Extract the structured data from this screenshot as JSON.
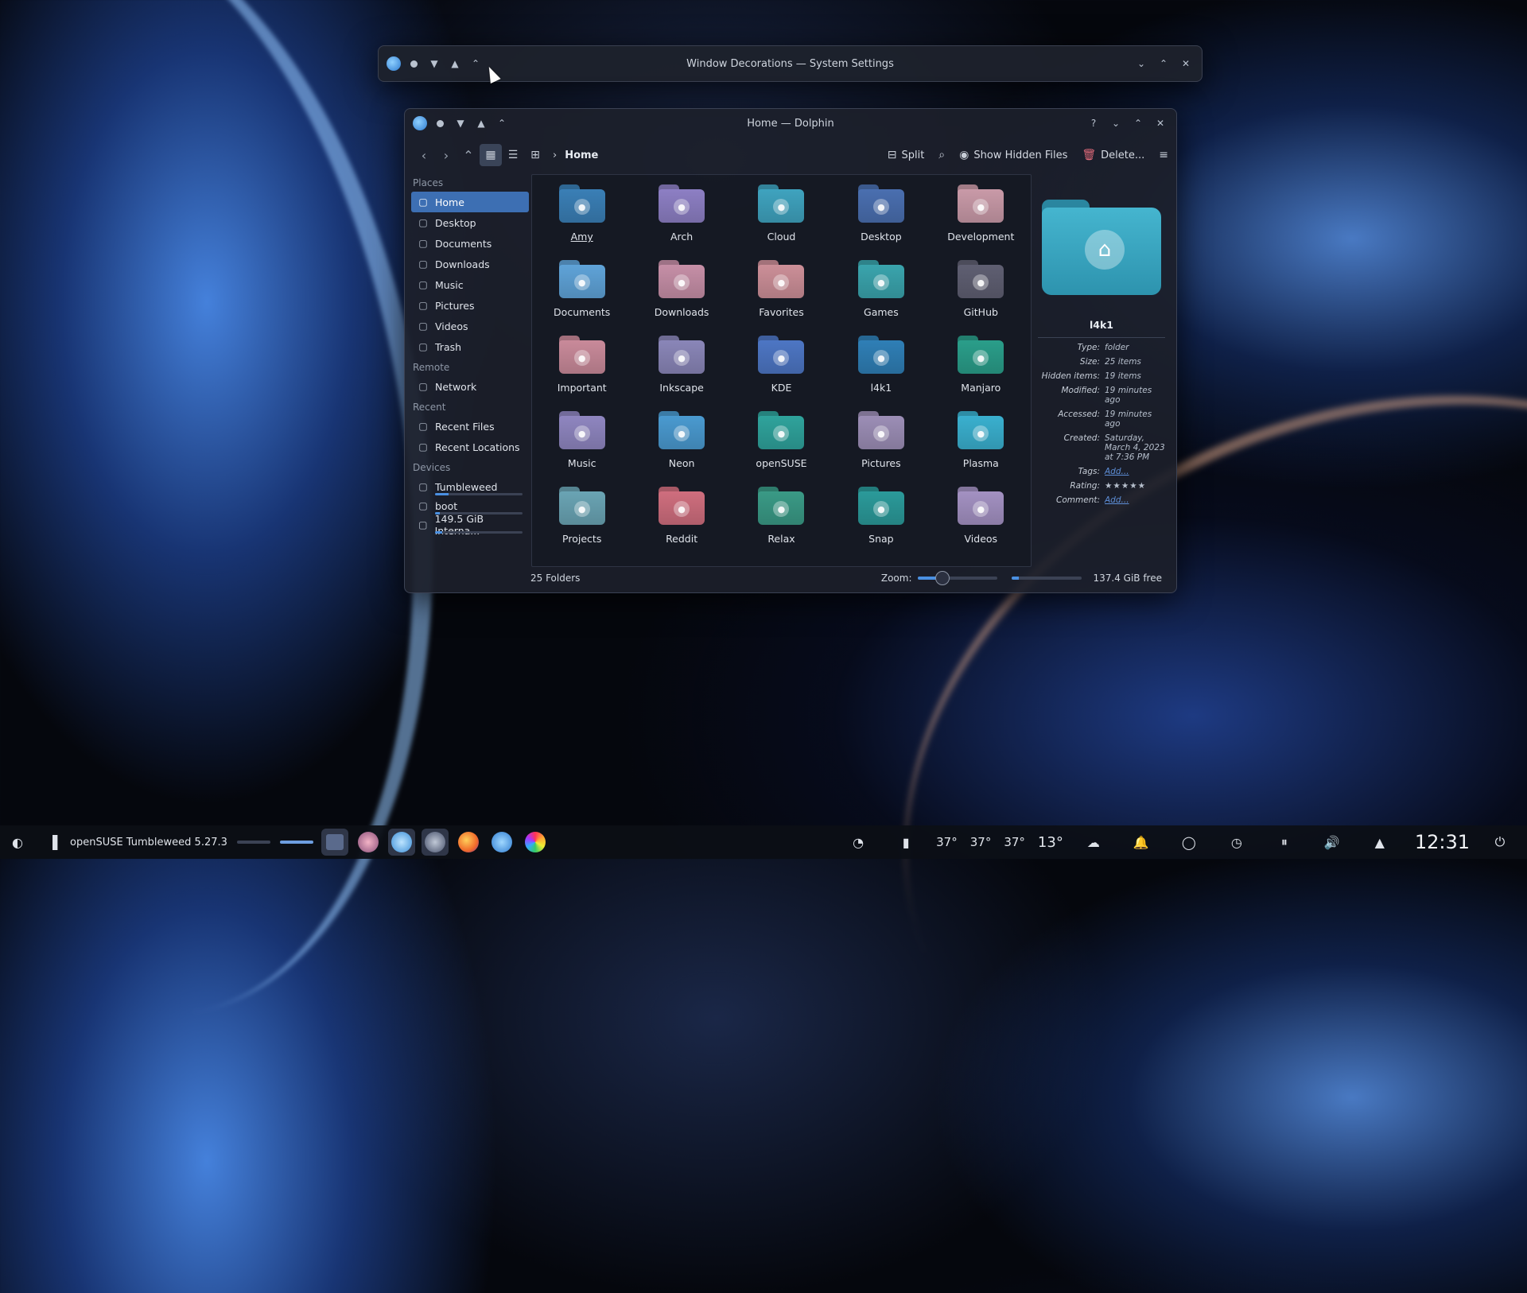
{
  "settings_window": {
    "title": "Window Decorations — System Settings"
  },
  "dolphin": {
    "title": "Home — Dolphin",
    "breadcrumb": "Home",
    "toolbar": {
      "split": "Split",
      "show_hidden": "Show Hidden Files",
      "delete": "Delete..."
    },
    "sidebar": {
      "places_label": "Places",
      "places": [
        {
          "label": "Home",
          "icon": "home-icon"
        },
        {
          "label": "Desktop",
          "icon": "desktop-icon"
        },
        {
          "label": "Documents",
          "icon": "documents-icon"
        },
        {
          "label": "Downloads",
          "icon": "downloads-icon"
        },
        {
          "label": "Music",
          "icon": "music-icon"
        },
        {
          "label": "Pictures",
          "icon": "pictures-icon"
        },
        {
          "label": "Videos",
          "icon": "videos-icon"
        },
        {
          "label": "Trash",
          "icon": "trash-icon"
        }
      ],
      "remote_label": "Remote",
      "remote": [
        {
          "label": "Network",
          "icon": "network-icon"
        }
      ],
      "recent_label": "Recent",
      "recent": [
        {
          "label": "Recent Files",
          "icon": "recent-files-icon"
        },
        {
          "label": "Recent Locations",
          "icon": "recent-locations-icon"
        }
      ],
      "devices_label": "Devices",
      "devices": [
        {
          "label": "Tumbleweed",
          "icon": "drive-icon",
          "used": 0.15
        },
        {
          "label": "boot",
          "icon": "drive-icon",
          "used": 0.05
        },
        {
          "label": "149.5 GiB Interna...",
          "icon": "drive-icon",
          "used": 0.08
        }
      ]
    },
    "folders": [
      {
        "name": "Amy",
        "color": "#3a7fb6"
      },
      {
        "name": "Arch",
        "color": "#8d7fc4"
      },
      {
        "name": "Cloud",
        "color": "#3fa3bf"
      },
      {
        "name": "Desktop",
        "color": "#4a6fb0"
      },
      {
        "name": "Development",
        "color": "#c99aa8"
      },
      {
        "name": "Documents",
        "color": "#5fa3d8"
      },
      {
        "name": "Downloads",
        "color": "#c68fa7"
      },
      {
        "name": "Favorites",
        "color": "#cc8f98"
      },
      {
        "name": "Games",
        "color": "#3aa4ad"
      },
      {
        "name": "GitHub",
        "color": "#5f5f72"
      },
      {
        "name": "Important",
        "color": "#c98a9a"
      },
      {
        "name": "Inkscape",
        "color": "#8a86b8"
      },
      {
        "name": "KDE",
        "color": "#4d76c4"
      },
      {
        "name": "l4k1",
        "color": "#2f7fb6"
      },
      {
        "name": "Manjaro",
        "color": "#2a9e8a"
      },
      {
        "name": "Music",
        "color": "#8f86c0"
      },
      {
        "name": "Neon",
        "color": "#4a9ad0"
      },
      {
        "name": "openSUSE",
        "color": "#2fa39c"
      },
      {
        "name": "Pictures",
        "color": "#9c8eb6"
      },
      {
        "name": "Plasma",
        "color": "#3ab0cf"
      },
      {
        "name": "Projects",
        "color": "#6aa4b4"
      },
      {
        "name": "Reddit",
        "color": "#cf6e7e"
      },
      {
        "name": "Relax",
        "color": "#3a9a86"
      },
      {
        "name": "Snap",
        "color": "#2b9a9a"
      },
      {
        "name": "Videos",
        "color": "#a391c2"
      }
    ],
    "info": {
      "name": "l4k1",
      "type_k": "Type:",
      "type_v": "folder",
      "size_k": "Size:",
      "size_v": "25 items",
      "hidden_k": "Hidden items:",
      "hidden_v": "19 items",
      "modified_k": "Modified:",
      "modified_v": "19 minutes ago",
      "accessed_k": "Accessed:",
      "accessed_v": "19 minutes ago",
      "created_k": "Created:",
      "created_v": "Saturday, March 4, 2023 at 7:36 PM",
      "tags_k": "Tags:",
      "tags_v": "Add...",
      "rating_k": "Rating:",
      "rating_stars": 5,
      "comment_k": "Comment:",
      "comment_v": "Add..."
    },
    "status": {
      "count": "25 Folders",
      "zoom_label": "Zoom:",
      "zoom_level": 0.3,
      "free": "137.4 GiB free",
      "used_fraction": 0.1
    }
  },
  "taskbar": {
    "task_label": "openSUSE Tumbleweed 5.27.3",
    "temps": [
      "37°",
      "37°",
      "37°"
    ],
    "weather": "13°",
    "clock": "12:31"
  },
  "colors": {
    "accent": "#3d6fb3",
    "link": "#5e8fd8"
  }
}
